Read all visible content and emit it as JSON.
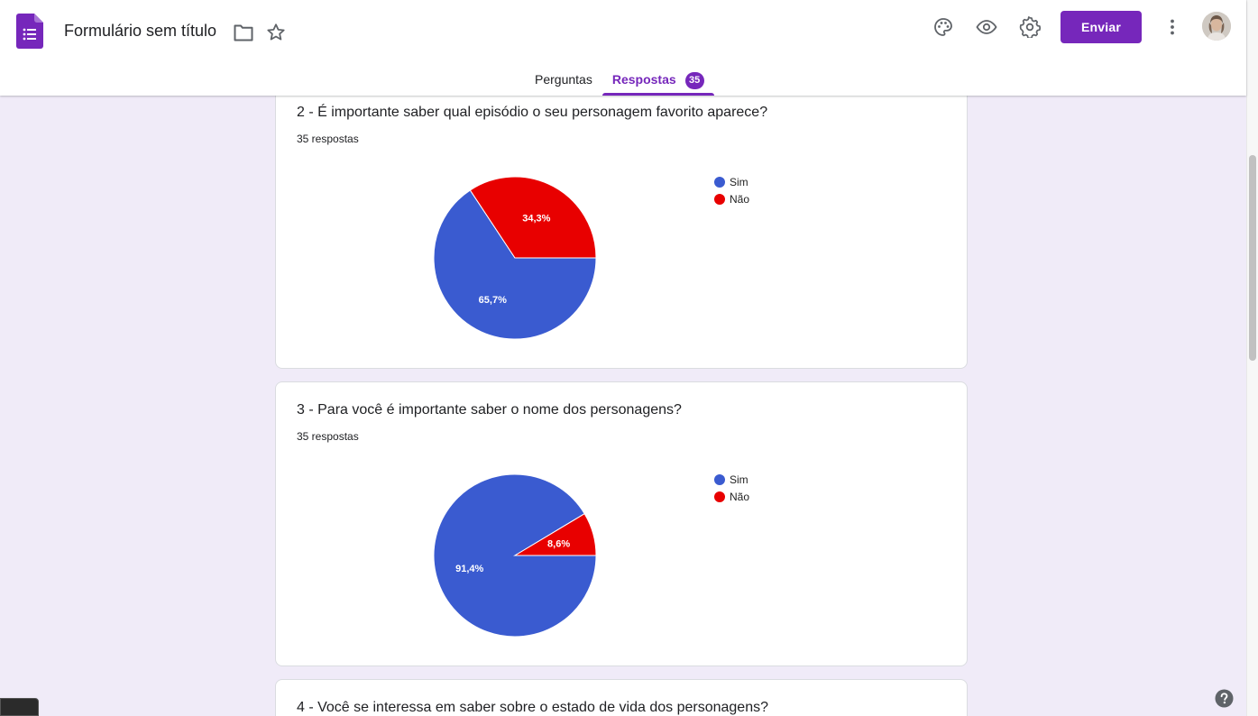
{
  "header": {
    "title": "Formulário sem título",
    "send_label": "Enviar",
    "icons": [
      "forms-logo-icon",
      "folder-icon",
      "star-icon",
      "palette-icon",
      "eye-icon",
      "gear-icon",
      "more-vert-icon",
      "avatar"
    ]
  },
  "tabs": [
    {
      "label": "Perguntas",
      "active": false
    },
    {
      "label": "Respostas",
      "active": true,
      "badge": "35"
    }
  ],
  "colors": {
    "accent": "#7627bb",
    "background": "#f0ebf8",
    "sim": "#3a5bd0",
    "nao": "#e80000"
  },
  "questions": [
    {
      "title": "2 - É importante saber qual episódio o seu personagem favorito aparece?",
      "count": "35 respostas",
      "legend": [
        "Sim",
        "Não"
      ],
      "slice_labels": [
        "65,7%",
        "34,3%"
      ]
    },
    {
      "title": "3 - Para você é importante saber o nome dos personagens?",
      "count": "35 respostas",
      "legend": [
        "Sim",
        "Não"
      ],
      "slice_labels": [
        "91,4%",
        "8,6%"
      ]
    },
    {
      "title": "4 - Você se interessa em saber sobre o estado de vida dos personagens?"
    }
  ],
  "chart_data": [
    {
      "type": "pie",
      "categories": [
        "Sim",
        "Não"
      ],
      "values": [
        65.7,
        34.3
      ],
      "legend": "right"
    },
    {
      "type": "pie",
      "categories": [
        "Sim",
        "Não"
      ],
      "values": [
        91.4,
        8.6
      ],
      "legend": "right"
    }
  ]
}
